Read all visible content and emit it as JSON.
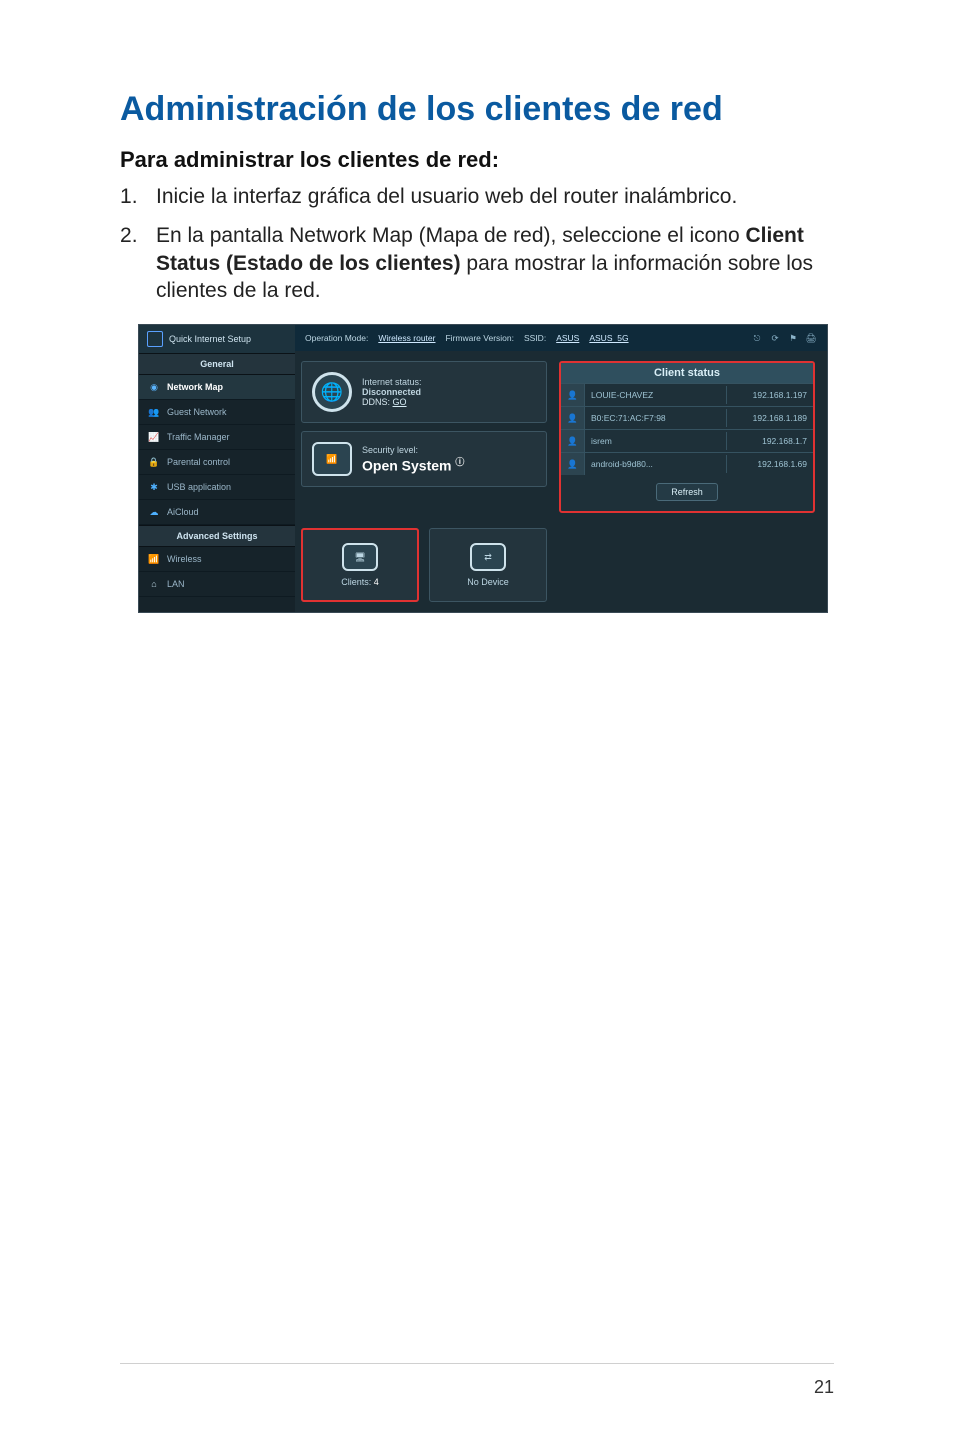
{
  "page": {
    "title": "Administración de los clientes de red",
    "subtitle": "Para administrar los clientes de red:",
    "steps": {
      "s1": "Inicie la interfaz gráfica del usuario web del router inalámbrico.",
      "s2_a": "En la pantalla Network Map (Mapa de red), seleccione el icono ",
      "s2_bold": "Client Status (Estado de los clientes)",
      "s2_b": " para mostrar la información sobre los clientes de la red."
    },
    "number": "21"
  },
  "router": {
    "topbar": {
      "op_mode_label": "Operation Mode:",
      "op_mode_value": "Wireless router",
      "fw_label": "Firmware Version:",
      "ssid_label": "SSID:",
      "ssid1": "ASUS",
      "ssid2": "ASUS_5G"
    },
    "sidebar": {
      "qis": "Quick Internet Setup",
      "general": "General",
      "advanced": "Advanced Settings",
      "items": [
        {
          "label": "Network Map",
          "color": "#5bb5ff"
        },
        {
          "label": "Guest Network",
          "color": "#5bb5ff"
        },
        {
          "label": "Traffic Manager",
          "color": "#5bb5ff"
        },
        {
          "label": "Parental control",
          "color": "#f0b74a"
        },
        {
          "label": "USB application",
          "color": "#4fb1ff"
        },
        {
          "label": "AiCloud",
          "color": "#4fb1ff"
        }
      ],
      "adv_items": [
        {
          "label": "Wireless",
          "color": "#4fb1ff"
        },
        {
          "label": "LAN",
          "color": "#bcd6e3"
        }
      ]
    },
    "cards": {
      "internet_status_label": "Internet status:",
      "internet_status_value": "Disconnected",
      "ddns_label": "DDNS:",
      "ddns_value": "GO",
      "security_label": "Security level:",
      "security_value": "Open System"
    },
    "tiles": {
      "clients_label": "Clients:",
      "clients_count": "4",
      "usb_label": "No Device"
    },
    "client_status": {
      "header": "Client status",
      "refresh": "Refresh",
      "rows": [
        {
          "name": "LOUIE-CHAVEZ",
          "ip": "192.168.1.197"
        },
        {
          "name": "B0:EC:71:AC:F7:98",
          "ip": "192.168.1.189"
        },
        {
          "name": "isrem",
          "ip": "192.168.1.7"
        },
        {
          "name": "android-b9d80...",
          "ip": "192.168.1.69"
        }
      ]
    }
  }
}
